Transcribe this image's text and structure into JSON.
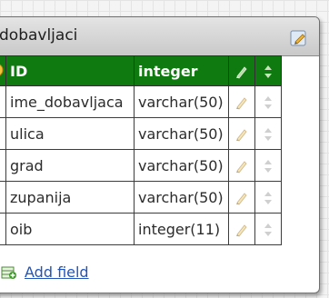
{
  "table": {
    "title": "dobavljaci",
    "header": {
      "name": "ID",
      "type": "integer"
    },
    "fields": [
      {
        "name": "ime_dobavljaca",
        "type": "varchar(50)"
      },
      {
        "name": "ulica",
        "type": "varchar(50)"
      },
      {
        "name": "grad",
        "type": "varchar(50)"
      },
      {
        "name": "zupanija",
        "type": "varchar(50)"
      },
      {
        "name": "oib",
        "type": "integer(11)"
      }
    ],
    "add_field_label": "Add field"
  },
  "colors": {
    "header_bg": "#0f7a0f",
    "link": "#2255bb"
  }
}
